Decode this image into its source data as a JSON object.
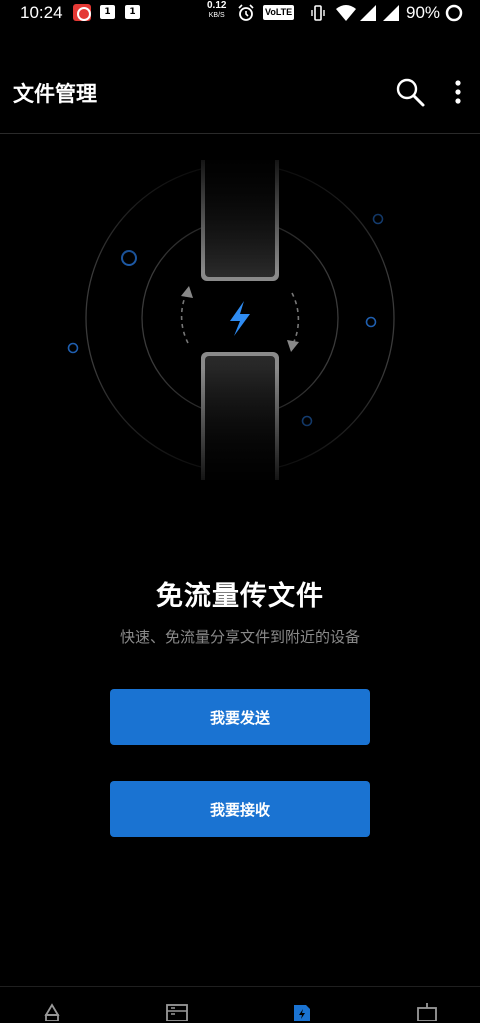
{
  "status_bar": {
    "time": "10:24",
    "notif_badge_1": "1",
    "notif_badge_2": "1",
    "net_speed_value": "0.12",
    "net_speed_unit": "KB/S",
    "volte": "VoLTE",
    "battery_percent": "90%"
  },
  "toolbar": {
    "title": "文件管理",
    "search_icon": "search-icon",
    "more_icon": "more-vert-icon"
  },
  "main": {
    "headline": "免流量传文件",
    "subline": "快速、免流量分享文件到附近的设备",
    "send_button_label": "我要发送",
    "receive_button_label": "我要接收"
  },
  "bottom_nav": {
    "items": [
      "recent-icon",
      "categories-icon",
      "share-icon",
      "storage-icon"
    ],
    "active_index": 2
  },
  "colors": {
    "accent": "#1a73d2",
    "background": "#000000",
    "subtext": "#8a8a8a"
  }
}
